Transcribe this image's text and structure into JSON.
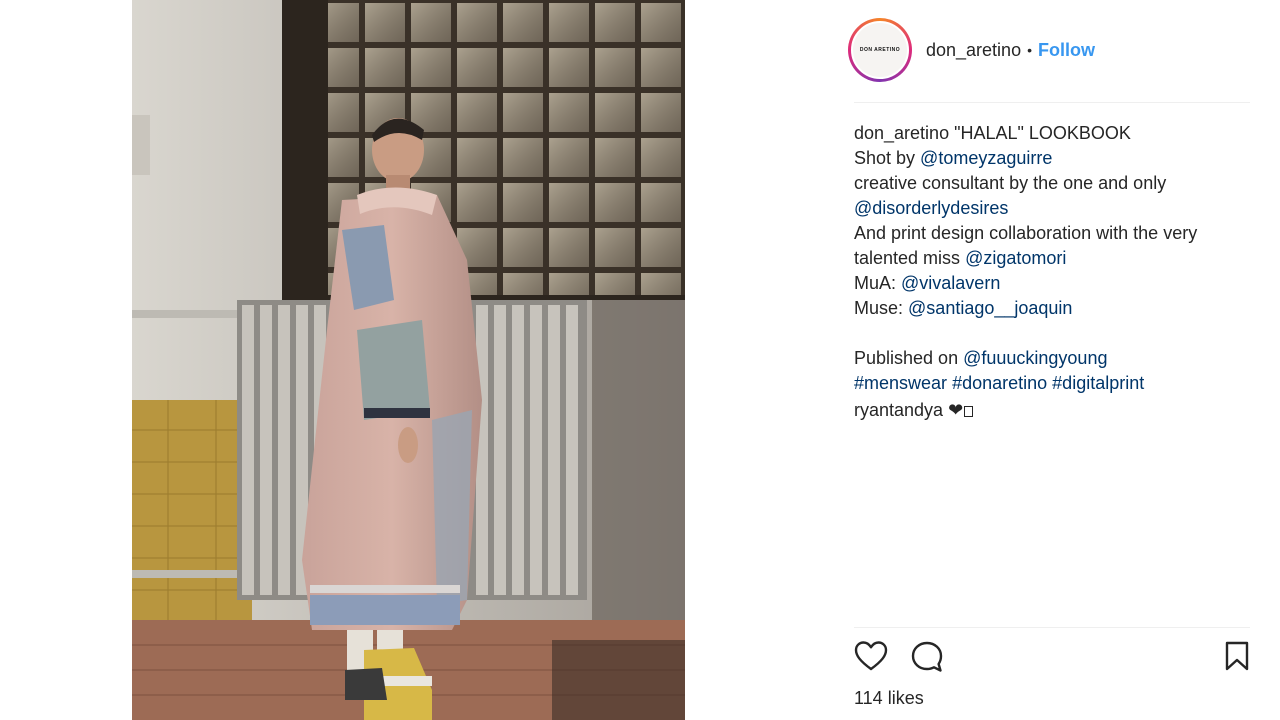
{
  "post": {
    "author": {
      "username": "don_aretino",
      "avatar_text": "DON ARETINO",
      "follow_label": "Follow",
      "separator": "•"
    },
    "caption": {
      "username": "don_aretino",
      "title": " \"HALAL\" LOOKBOOK",
      "shot_prefix": "Shot by ",
      "shot_mention": "@tomeyzaguirre",
      "consultant_text": "creative consultant by the one and only",
      "consultant_mention": "@disorderlydesires",
      "print_text_1": "And print design collaboration with the very",
      "print_text_2": "talented miss ",
      "print_mention": "@zigatomori",
      "mua_prefix": "MuA: ",
      "mua_mention": "@vivalavern",
      "muse_prefix": "Muse: ",
      "muse_mention": "@santiago__joaquin",
      "published_prefix": "Published on ",
      "published_mention": "@fuuuckingyoung",
      "tags": [
        "#menswear",
        "#donaretino",
        "#digitalprint"
      ]
    },
    "comment": {
      "username": "ryantandya",
      "text": " ❤"
    },
    "likes": {
      "count": "114",
      "label": " likes"
    },
    "icons": [
      "heart-icon",
      "comment-icon",
      "bookmark-icon"
    ]
  },
  "colors": {
    "link": "#003569",
    "follow": "#3897f0",
    "text": "#262626",
    "divider": "#efefef"
  }
}
